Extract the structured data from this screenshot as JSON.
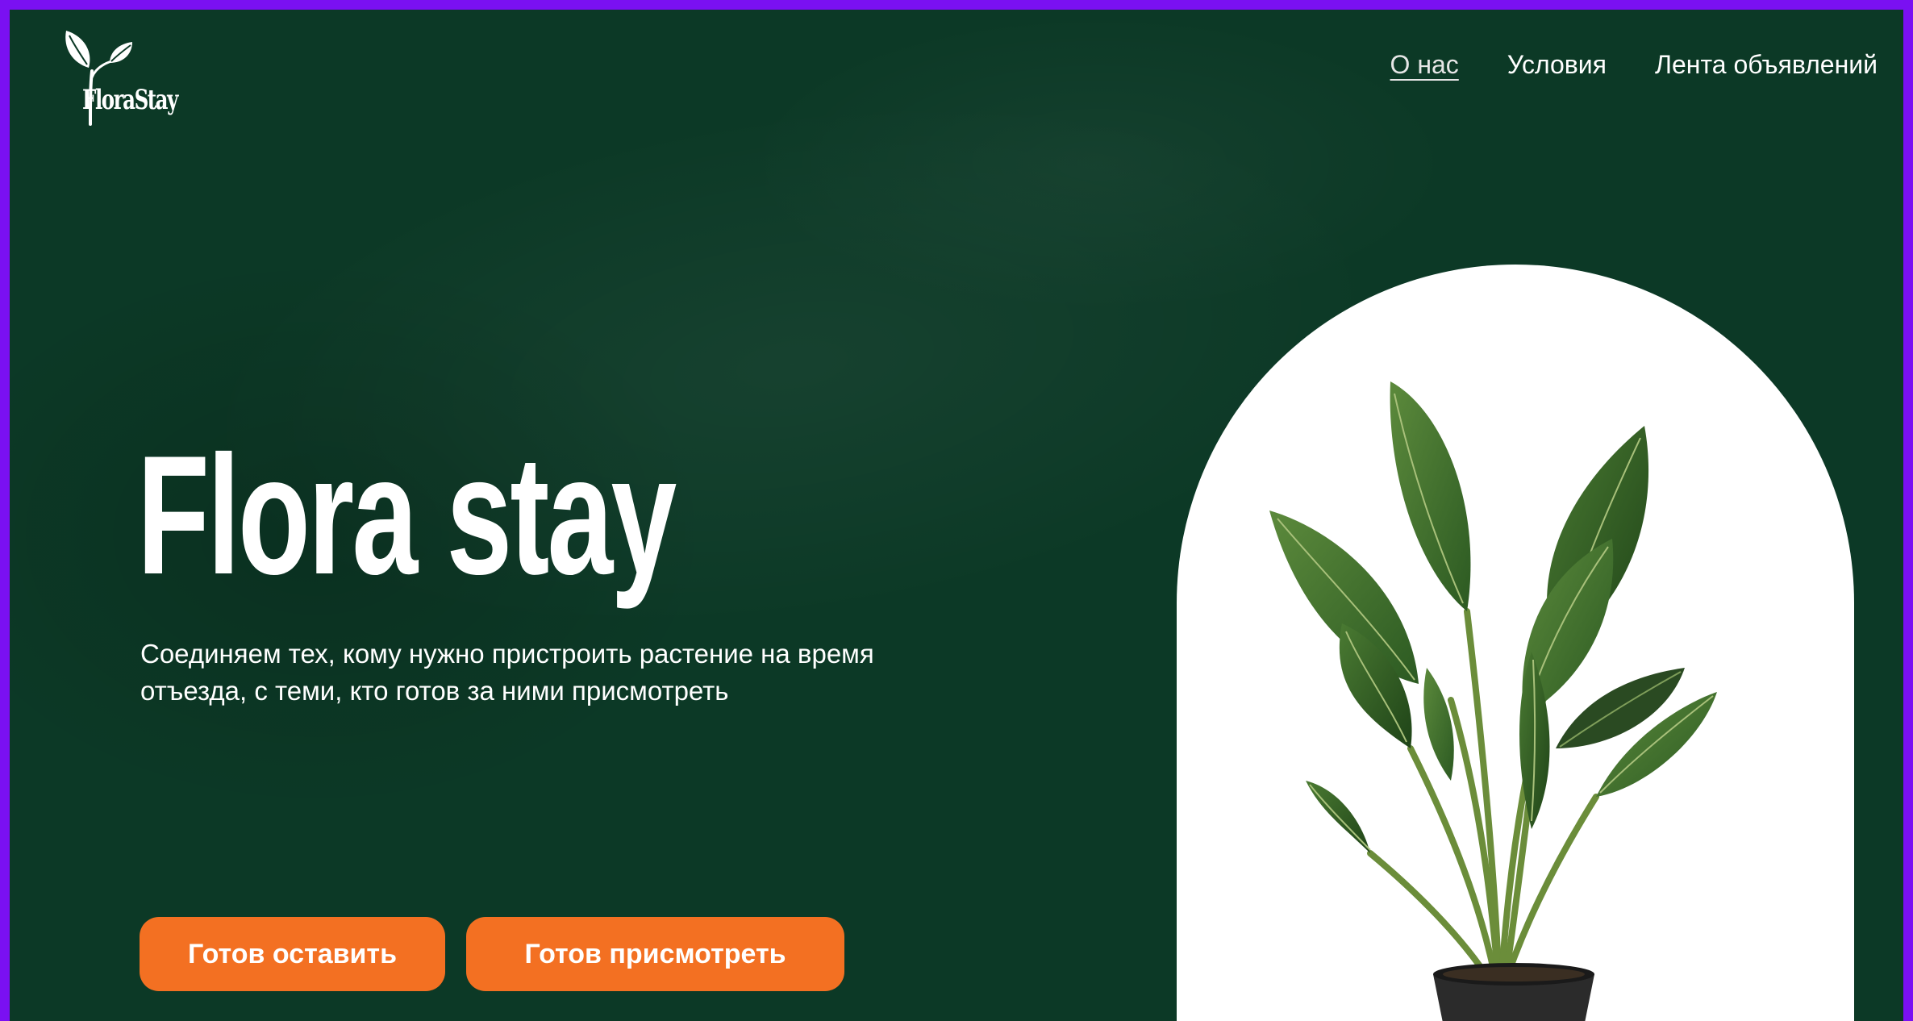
{
  "logo": {
    "text": "FloraStay"
  },
  "nav": {
    "items": [
      {
        "label": "О нас",
        "active": true
      },
      {
        "label": "Условия",
        "active": false
      },
      {
        "label": "Лента объявлений",
        "active": false
      }
    ]
  },
  "hero": {
    "title": "Flora stay",
    "subtitle_line1": "Соединяем тех, кому нужно пристроить растение на время",
    "subtitle_line2": "отъезда, с теми, кто готов за ними присмотреть",
    "button_leave": "Готов оставить",
    "button_care": "Готов присмотреть",
    "image": "potted-plant-image"
  },
  "colors": {
    "frame": "#7a10f2",
    "background": "#0c3926",
    "accent": "#f37022",
    "text": "#ffffff",
    "arch": "#ffffff"
  }
}
